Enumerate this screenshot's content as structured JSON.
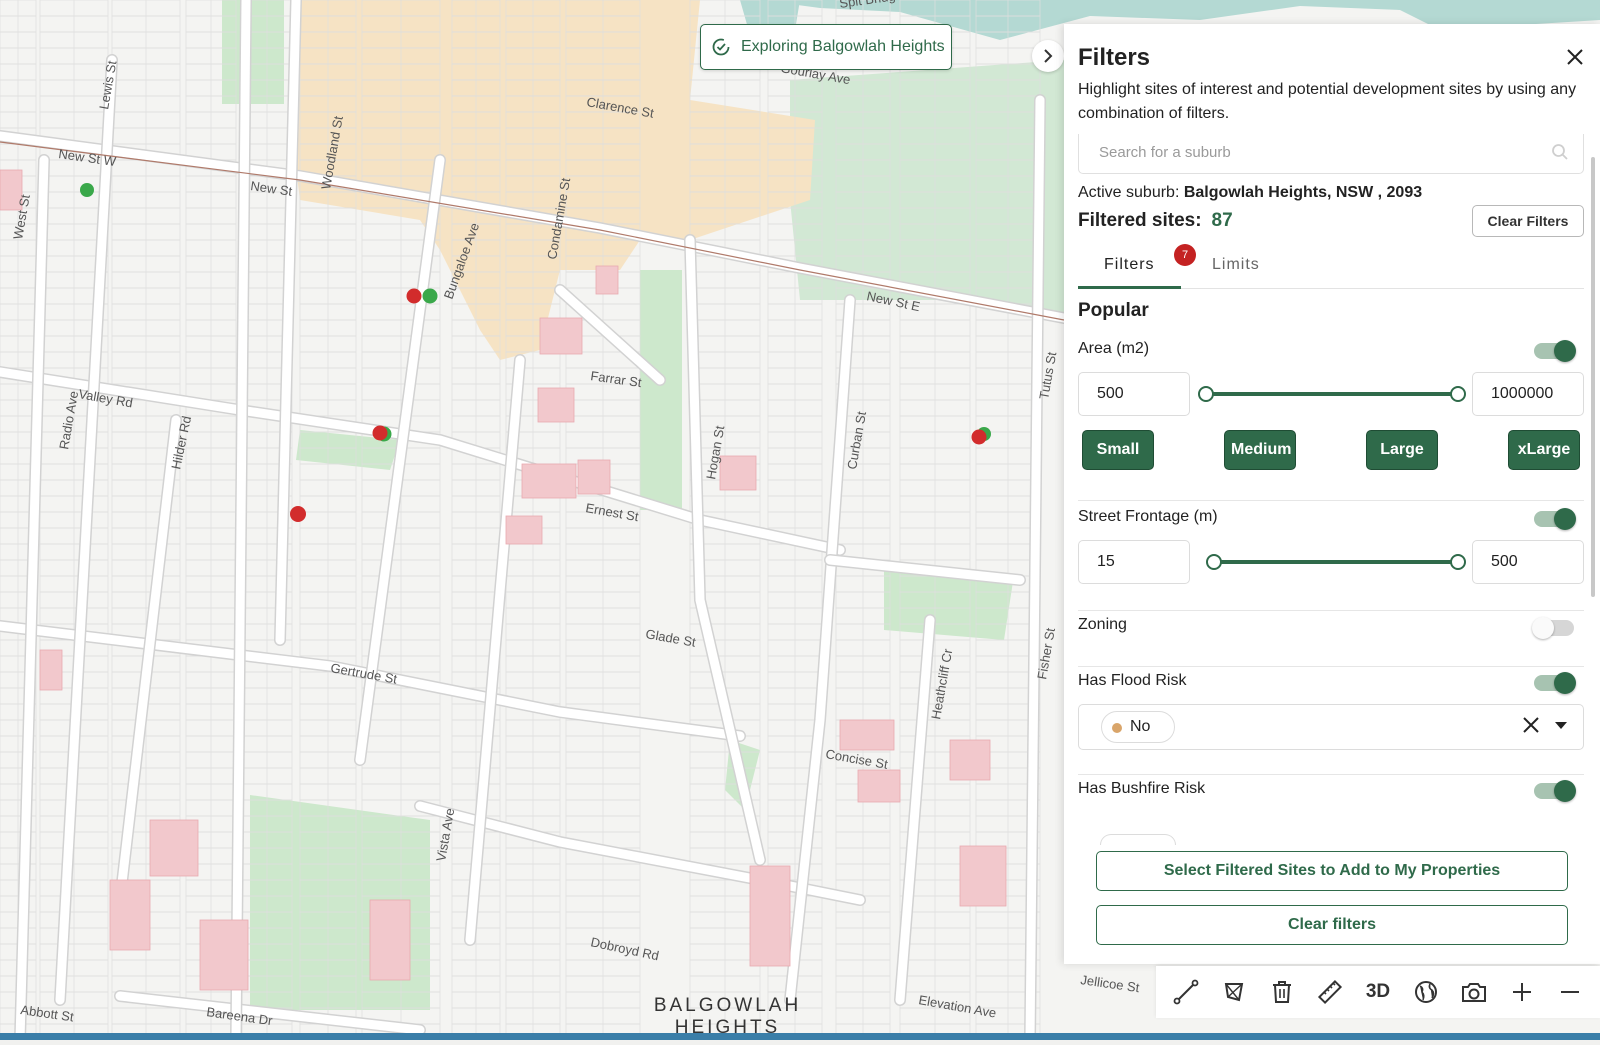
{
  "map": {
    "banner_text": "Exploring Balgowlah Heights",
    "area_label_line1": "BALGOWLAH",
    "area_label_line2": "HEIGHTS",
    "streets": [
      "New St W",
      "New St",
      "New St E",
      "Woodland St",
      "Bungaloe Ave",
      "Condamine St",
      "Clarence St",
      "Farrar St",
      "Valley Rd",
      "Hilder Rd",
      "Radio Ave",
      "Lewis St",
      "West St",
      "Gertrude St",
      "Ernest St",
      "Glade St",
      "Hogan St",
      "Curban St",
      "Tutus St",
      "Concise St",
      "Heathcliff Cr",
      "Fisher St",
      "Vista Ave",
      "Dobroyd Rd",
      "Jellicoe St",
      "Elevation Ave",
      "Bareena Dr",
      "Abbott St",
      "Gourlay Ave",
      "Spit Bridge Walk"
    ]
  },
  "panel": {
    "title": "Filters",
    "description": "Highlight sites of interest and potential development sites by using any combination of filters.",
    "search_placeholder": "Search for a suburb",
    "active_suburb_label": "Active suburb:",
    "active_suburb_value": "Balgowlah Heights, NSW , 2093",
    "filtered_sites_label": "Filtered sites:",
    "filtered_sites_count": "87",
    "clear_filters_top": "Clear Filters",
    "tabs": [
      {
        "label": "Filters",
        "badge": "7",
        "active": true
      },
      {
        "label": "Limits",
        "active": false
      }
    ],
    "section_popular": "Popular",
    "area": {
      "label": "Area (m2)",
      "enabled": true,
      "min": "500",
      "max": "1000000",
      "presets": [
        "Small",
        "Medium",
        "Large",
        "xLarge"
      ]
    },
    "street_frontage": {
      "label": "Street Frontage (m)",
      "enabled": true,
      "min": "15",
      "max": "500"
    },
    "zoning": {
      "label": "Zoning",
      "enabled": false
    },
    "flood_risk": {
      "label": "Has Flood Risk",
      "enabled": true,
      "selected": "No"
    },
    "bushfire_risk": {
      "label": "Has Bushfire Risk",
      "enabled": true
    },
    "select_sites_button": "Select Filtered Sites to Add to My Properties",
    "clear_filters_bottom": "Clear filters"
  },
  "toolbar": {
    "tools": [
      {
        "name": "line-tool-icon"
      },
      {
        "name": "polygon-tool-icon"
      },
      {
        "name": "trash-icon"
      },
      {
        "name": "ruler-icon"
      },
      {
        "name": "3d-toggle",
        "label": "3D"
      },
      {
        "name": "globe-icon"
      },
      {
        "name": "camera-icon"
      },
      {
        "name": "zoom-in-icon"
      },
      {
        "name": "zoom-out-icon"
      }
    ]
  },
  "colors": {
    "accent": "#2f6a4a",
    "badge": "#c42222",
    "commercial_zone": "#f6e3c4",
    "park": "#cde8cc",
    "water": "#b4d9d3",
    "highlight_parcel": "#f2c8cc"
  }
}
